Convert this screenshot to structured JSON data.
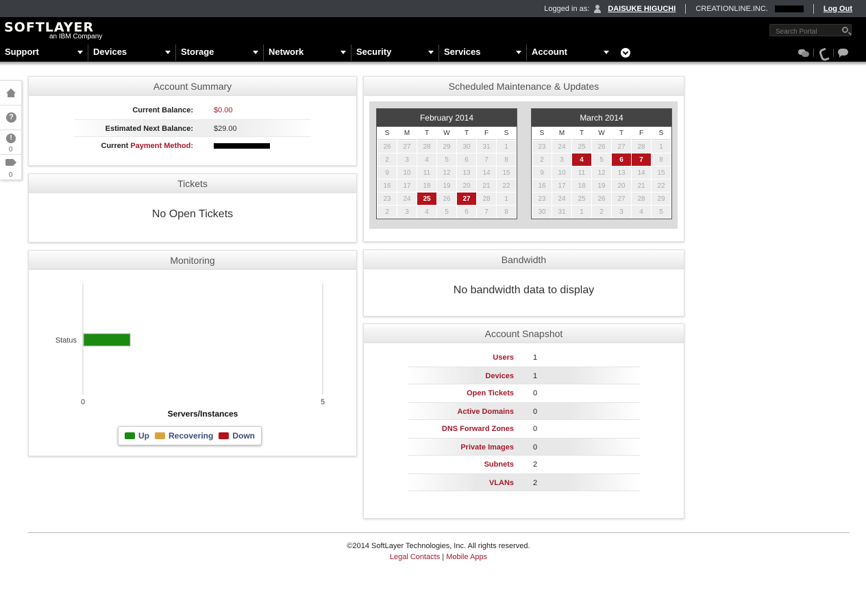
{
  "topbar": {
    "logged_in_label": "Logged in as:",
    "user": "DAISUKE HIGUCHI",
    "company": "CREATIONLINE.INC.",
    "logout": "Log Out"
  },
  "logo": {
    "brand": "SOFTLAYER",
    "sub": "an IBM Company"
  },
  "search": {
    "placeholder": "Search Portal"
  },
  "nav": [
    "Support",
    "Devices",
    "Storage",
    "Network",
    "Security",
    "Services",
    "Account"
  ],
  "sidebar": {
    "alerts_count": "0",
    "tags_count": "0"
  },
  "account_summary": {
    "title": "Account Summary",
    "rows": [
      {
        "label": "Current Balance:",
        "value": "$0.00"
      },
      {
        "label": "Estimated Next Balance:",
        "value": "$29.00"
      },
      {
        "label_prefix": "Current",
        "label_link": "Payment Method",
        "label_suffix": ":"
      }
    ]
  },
  "tickets": {
    "title": "Tickets",
    "empty": "No Open Tickets"
  },
  "monitoring": {
    "title": "Monitoring",
    "legend": [
      "Up",
      "Recovering",
      "Down"
    ]
  },
  "chart_data": {
    "type": "bar",
    "orientation": "horizontal",
    "categories": [
      "Status"
    ],
    "series": [
      {
        "name": "Up",
        "values": [
          1
        ],
        "color": "#1a8a12"
      },
      {
        "name": "Recovering",
        "values": [
          0
        ],
        "color": "#d9a440"
      },
      {
        "name": "Down",
        "values": [
          0
        ],
        "color": "#b5121b"
      }
    ],
    "xlabel": "Servers/Instances",
    "xlim": [
      0,
      5
    ],
    "xticks": [
      "0",
      "5"
    ],
    "legend_position": "bottom"
  },
  "maintenance": {
    "title": "Scheduled Maintenance & Updates",
    "weekdays": [
      "S",
      "M",
      "T",
      "W",
      "T",
      "F",
      "S"
    ],
    "calendars": [
      {
        "month": "February 2014",
        "weeks": [
          [
            "26",
            "27",
            "28",
            "29",
            "30",
            "31",
            "1"
          ],
          [
            "2",
            "3",
            "4",
            "5",
            "6",
            "7",
            "8"
          ],
          [
            "9",
            "10",
            "11",
            "12",
            "13",
            "14",
            "15"
          ],
          [
            "16",
            "17",
            "18",
            "19",
            "20",
            "21",
            "22"
          ],
          [
            "23",
            "24",
            "25",
            "26",
            "27",
            "28",
            "1"
          ],
          [
            "2",
            "3",
            "4",
            "5",
            "6",
            "7",
            "8"
          ]
        ],
        "highlight": [
          [
            4,
            2
          ],
          [
            4,
            4
          ]
        ]
      },
      {
        "month": "March 2014",
        "weeks": [
          [
            "23",
            "24",
            "25",
            "26",
            "27",
            "28",
            "1"
          ],
          [
            "2",
            "3",
            "4",
            "5",
            "6",
            "7",
            "8"
          ],
          [
            "9",
            "10",
            "11",
            "12",
            "13",
            "14",
            "15"
          ],
          [
            "16",
            "17",
            "18",
            "19",
            "20",
            "21",
            "22"
          ],
          [
            "23",
            "24",
            "25",
            "26",
            "27",
            "28",
            "29"
          ],
          [
            "30",
            "31",
            "1",
            "2",
            "3",
            "4",
            "5"
          ]
        ],
        "highlight": [
          [
            1,
            2
          ],
          [
            1,
            4
          ],
          [
            1,
            5
          ]
        ]
      }
    ]
  },
  "bandwidth": {
    "title": "Bandwidth",
    "empty": "No bandwidth data to display"
  },
  "snapshot": {
    "title": "Account Snapshot",
    "rows": [
      {
        "label": "Users",
        "value": "1"
      },
      {
        "label": "Devices",
        "value": "1"
      },
      {
        "label": "Open Tickets",
        "value": "0"
      },
      {
        "label": "Active Domains",
        "value": "0"
      },
      {
        "label": "DNS Forward Zones",
        "value": "0"
      },
      {
        "label": "Private Images",
        "value": "0"
      },
      {
        "label": "Subnets",
        "value": "2"
      },
      {
        "label": "VLANs",
        "value": "2"
      }
    ]
  },
  "footer": {
    "copyright": "©2014 SoftLayer Technologies, Inc. All rights reserved.",
    "legal": "Legal Contacts",
    "separator": "|",
    "mobile": "Mobile Apps"
  }
}
